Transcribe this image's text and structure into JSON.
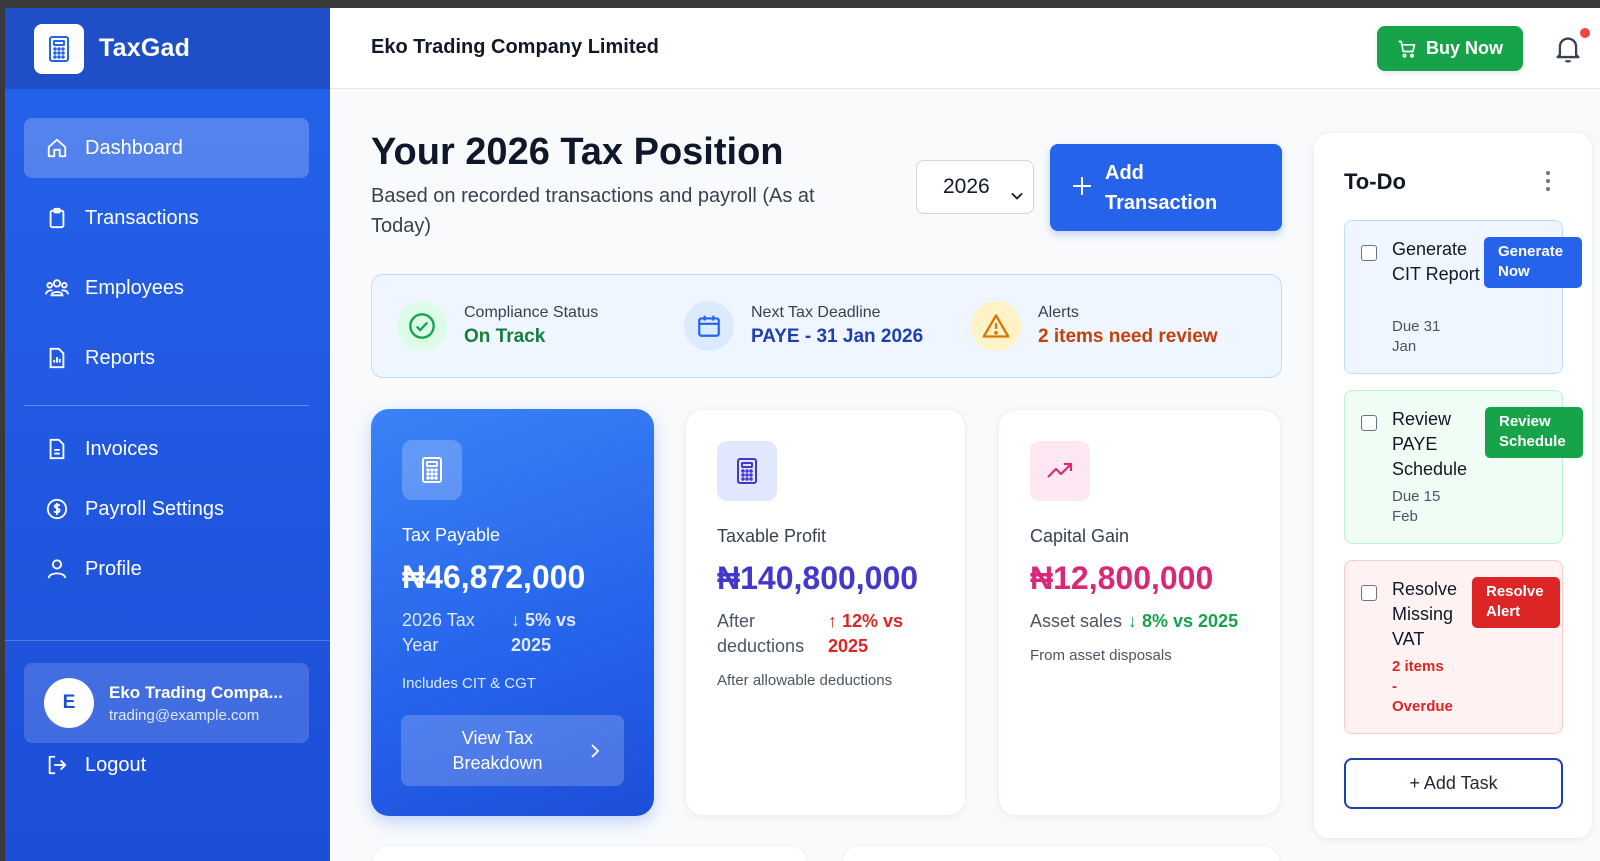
{
  "app": {
    "brand": "TaxGad"
  },
  "sidebar": {
    "items": [
      {
        "label": "Dashboard",
        "icon": "home-icon",
        "active": true
      },
      {
        "label": "Transactions",
        "icon": "clipboard-icon"
      },
      {
        "label": "Employees",
        "icon": "users-icon"
      },
      {
        "label": "Reports",
        "icon": "report-icon"
      },
      {
        "label": "Invoices",
        "icon": "document-icon"
      },
      {
        "label": "Payroll Settings",
        "icon": "dollar-icon"
      },
      {
        "label": "Profile",
        "icon": "user-icon"
      }
    ],
    "user": {
      "initial": "E",
      "name": "Eko Trading Compa...",
      "email": "trading@example.com"
    },
    "logout_label": "Logout"
  },
  "header": {
    "company": "Eko Trading Company Limited",
    "buy_label": "Buy Now"
  },
  "main": {
    "title": "Your 2026 Tax Position",
    "subtitle": "Based on recorded transactions and payroll (As at Today)",
    "year": "2026",
    "add_transaction_label": "Add Transaction"
  },
  "status": {
    "compliance": {
      "label": "Compliance Status",
      "value": "On Track",
      "color": "#15803d"
    },
    "deadline": {
      "label": "Next Tax Deadline",
      "value": "PAYE - 31 Jan 2026",
      "color": "#1e40af"
    },
    "alerts": {
      "label": "Alerts",
      "value": "2 items need review",
      "color": "#c2410c"
    }
  },
  "cards": {
    "tax_payable": {
      "label": "Tax Payable",
      "value": "₦46,872,000",
      "sub": "2026 Tax Year",
      "trend": "↓ 5% vs 2025",
      "note": "Includes CIT & CGT",
      "button": "View Tax Breakdown"
    },
    "taxable_profit": {
      "label": "Taxable Profit",
      "value": "₦140,800,000",
      "sub": "After deductions",
      "trend": "↑ 12% vs 2025",
      "note": "After allowable deductions",
      "value_color": "#4338ca",
      "trend_color": "#dc2626"
    },
    "capital_gain": {
      "label": "Capital Gain",
      "value": "₦12,800,000",
      "sub": "Asset sales",
      "trend": "↓ 8% vs 2025",
      "note": "From asset disposals",
      "value_color": "#db2777",
      "trend_color": "#16a34a"
    }
  },
  "todo": {
    "title": "To-Do",
    "tasks": [
      {
        "title": "Generate CIT Report",
        "due": "Due 31 Jan",
        "button": "Generate Now",
        "button_color": "#2563eb"
      },
      {
        "title": "Review PAYE Schedule",
        "due": "Due 15 Feb",
        "button": "Review Schedule",
        "button_color": "#16a34a"
      },
      {
        "title": "Resolve Missing VAT",
        "due": "2 items - Overdue",
        "button": "Resolve Alert",
        "button_color": "#dc2626"
      }
    ],
    "add_task_label": "+ Add Task"
  },
  "colors": {
    "primary": "#2563eb",
    "success": "#16a34a",
    "danger": "#dc2626",
    "warning": "#f59e0b"
  }
}
